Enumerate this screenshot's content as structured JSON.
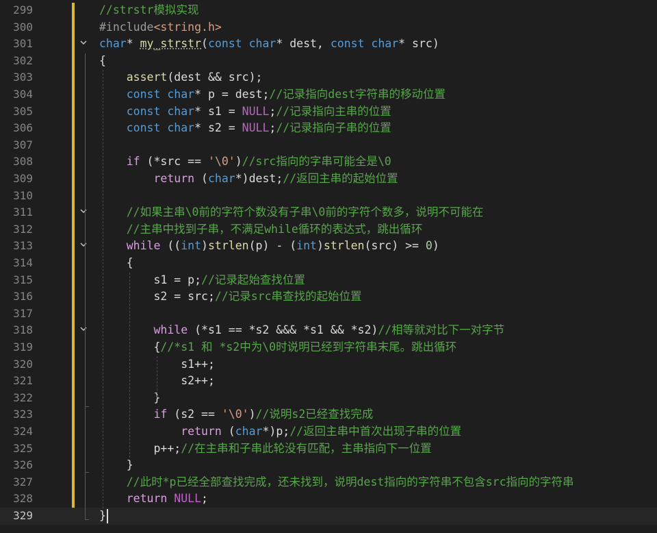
{
  "editor": {
    "current_line": 329,
    "lines": [
      {
        "n": "299",
        "tokens": [
          {
            "t": "//strstr模拟实现",
            "c": "comment"
          }
        ]
      },
      {
        "n": "300",
        "tokens": [
          {
            "t": "#include",
            "c": "inc"
          },
          {
            "t": "<string.h>",
            "c": "str"
          }
        ]
      },
      {
        "n": "301",
        "fold": "open",
        "tokens": [
          {
            "t": "char",
            "c": "kw"
          },
          {
            "t": "* ",
            "c": "plain"
          },
          {
            "t": "my_strstr",
            "c": "fn",
            "u": true
          },
          {
            "t": "(",
            "c": "plain"
          },
          {
            "t": "const",
            "c": "kw"
          },
          {
            "t": " ",
            "c": "plain"
          },
          {
            "t": "char",
            "c": "kw"
          },
          {
            "t": "* dest, ",
            "c": "plain"
          },
          {
            "t": "const",
            "c": "kw"
          },
          {
            "t": " ",
            "c": "plain"
          },
          {
            "t": "char",
            "c": "kw"
          },
          {
            "t": "* src)",
            "c": "plain"
          }
        ]
      },
      {
        "n": "302",
        "tokens": [
          {
            "t": "{",
            "c": "plain"
          }
        ]
      },
      {
        "n": "303",
        "tokens": [
          {
            "t": "    ",
            "c": "plain"
          },
          {
            "t": "assert",
            "c": "fn"
          },
          {
            "t": "(dest && src);",
            "c": "plain"
          }
        ]
      },
      {
        "n": "304",
        "tokens": [
          {
            "t": "    ",
            "c": "plain"
          },
          {
            "t": "const",
            "c": "kw"
          },
          {
            "t": " ",
            "c": "plain"
          },
          {
            "t": "char",
            "c": "kw"
          },
          {
            "t": "* p = dest;",
            "c": "plain"
          },
          {
            "t": "//记录指向dest字符串的移动位置",
            "c": "comment"
          }
        ]
      },
      {
        "n": "305",
        "tokens": [
          {
            "t": "    ",
            "c": "plain"
          },
          {
            "t": "const",
            "c": "kw"
          },
          {
            "t": " ",
            "c": "plain"
          },
          {
            "t": "char",
            "c": "kw"
          },
          {
            "t": "* s1 = ",
            "c": "plain"
          },
          {
            "t": "NULL",
            "c": "macro"
          },
          {
            "t": ";",
            "c": "plain"
          },
          {
            "t": "//记录指向主串的位置",
            "c": "comment"
          }
        ]
      },
      {
        "n": "306",
        "tokens": [
          {
            "t": "    ",
            "c": "plain"
          },
          {
            "t": "const",
            "c": "kw"
          },
          {
            "t": " ",
            "c": "plain"
          },
          {
            "t": "char",
            "c": "kw"
          },
          {
            "t": "* s2 = ",
            "c": "plain"
          },
          {
            "t": "NULL",
            "c": "macro"
          },
          {
            "t": ";",
            "c": "plain"
          },
          {
            "t": "//记录指向子串的位置",
            "c": "comment"
          }
        ]
      },
      {
        "n": "307",
        "tokens": []
      },
      {
        "n": "308",
        "tokens": [
          {
            "t": "    ",
            "c": "plain"
          },
          {
            "t": "if",
            "c": "ctrl"
          },
          {
            "t": " (*src == ",
            "c": "plain"
          },
          {
            "t": "'\\0'",
            "c": "str"
          },
          {
            "t": ")",
            "c": "plain"
          },
          {
            "t": "//src指向的字串可能全是\\0",
            "c": "comment"
          }
        ]
      },
      {
        "n": "309",
        "tokens": [
          {
            "t": "        ",
            "c": "plain"
          },
          {
            "t": "return",
            "c": "ctrl"
          },
          {
            "t": " (",
            "c": "plain"
          },
          {
            "t": "char",
            "c": "kw"
          },
          {
            "t": "*)dest;",
            "c": "plain"
          },
          {
            "t": "//返回主串的起始位置",
            "c": "comment"
          }
        ]
      },
      {
        "n": "310",
        "tokens": []
      },
      {
        "n": "311",
        "fold": "open",
        "tokens": [
          {
            "t": "    ",
            "c": "plain"
          },
          {
            "t": "//如果主串\\0前的字符个数没有子串\\0前的字符个数多，说明不可能在",
            "c": "comment"
          }
        ]
      },
      {
        "n": "312",
        "tokens": [
          {
            "t": "    ",
            "c": "plain"
          },
          {
            "t": "//主串中找到子串，不满足while循环的表达式，跳出循环",
            "c": "comment"
          }
        ]
      },
      {
        "n": "313",
        "fold": "open",
        "tokens": [
          {
            "t": "    ",
            "c": "plain"
          },
          {
            "t": "while",
            "c": "ctrl"
          },
          {
            "t": " ((",
            "c": "plain"
          },
          {
            "t": "int",
            "c": "kw"
          },
          {
            "t": ")",
            "c": "plain"
          },
          {
            "t": "strlen",
            "c": "fn"
          },
          {
            "t": "(p) - (",
            "c": "plain"
          },
          {
            "t": "int",
            "c": "kw"
          },
          {
            "t": ")",
            "c": "plain"
          },
          {
            "t": "strlen",
            "c": "fn"
          },
          {
            "t": "(src) >= ",
            "c": "plain"
          },
          {
            "t": "0",
            "c": "num"
          },
          {
            "t": ")",
            "c": "plain"
          }
        ]
      },
      {
        "n": "314",
        "tokens": [
          {
            "t": "    {",
            "c": "plain"
          }
        ]
      },
      {
        "n": "315",
        "tokens": [
          {
            "t": "        s1 = p;",
            "c": "plain"
          },
          {
            "t": "//记录起始查找位置",
            "c": "comment"
          }
        ]
      },
      {
        "n": "316",
        "tokens": [
          {
            "t": "        s2 = src;",
            "c": "plain"
          },
          {
            "t": "//记录src串查找的起始位置",
            "c": "comment"
          }
        ]
      },
      {
        "n": "317",
        "tokens": []
      },
      {
        "n": "318",
        "fold": "open",
        "tokens": [
          {
            "t": "        ",
            "c": "plain"
          },
          {
            "t": "while",
            "c": "ctrl"
          },
          {
            "t": " (*s1 == *s2 &&& *s1 && *s2)",
            "c": "plain"
          },
          {
            "t": "//相等就对比下一对字节",
            "c": "comment"
          }
        ]
      },
      {
        "n": "319",
        "tokens": [
          {
            "t": "        {",
            "c": "plain"
          },
          {
            "t": "//*s1 和 *s2中为\\0时说明已经到字符串末尾。跳出循环",
            "c": "comment"
          }
        ]
      },
      {
        "n": "320",
        "tokens": [
          {
            "t": "            s1++;",
            "c": "plain"
          }
        ]
      },
      {
        "n": "321",
        "tokens": [
          {
            "t": "            s2++;",
            "c": "plain"
          }
        ]
      },
      {
        "n": "322",
        "tokens": [
          {
            "t": "        }",
            "c": "plain"
          }
        ]
      },
      {
        "n": "323",
        "tokens": [
          {
            "t": "        ",
            "c": "plain"
          },
          {
            "t": "if",
            "c": "ctrl"
          },
          {
            "t": " (s2 == ",
            "c": "plain"
          },
          {
            "t": "'\\0'",
            "c": "str"
          },
          {
            "t": ")",
            "c": "plain"
          },
          {
            "t": "//说明s2已经查找完成",
            "c": "comment"
          }
        ]
      },
      {
        "n": "324",
        "tokens": [
          {
            "t": "            ",
            "c": "plain"
          },
          {
            "t": "return",
            "c": "ctrl"
          },
          {
            "t": " (",
            "c": "plain"
          },
          {
            "t": "char",
            "c": "kw"
          },
          {
            "t": "*)p;",
            "c": "plain"
          },
          {
            "t": "//返回主串中首次出现子串的位置",
            "c": "comment"
          }
        ]
      },
      {
        "n": "325",
        "tokens": [
          {
            "t": "        p++;",
            "c": "plain"
          },
          {
            "t": "//在主串和子串此轮没有匹配，主串指向下一位置",
            "c": "comment"
          }
        ]
      },
      {
        "n": "326",
        "tokens": [
          {
            "t": "    }",
            "c": "plain"
          }
        ]
      },
      {
        "n": "327",
        "tokens": [
          {
            "t": "    ",
            "c": "plain"
          },
          {
            "t": "//此时*p已经全部查找完成，还未找到，说明dest指向的字符串不包含src指向的字符串",
            "c": "comment"
          }
        ]
      },
      {
        "n": "328",
        "tokens": [
          {
            "t": "    ",
            "c": "plain"
          },
          {
            "t": "return",
            "c": "ctrl"
          },
          {
            "t": " ",
            "c": "plain"
          },
          {
            "t": "NULL",
            "c": "macro"
          },
          {
            "t": ";",
            "c": "plain"
          }
        ]
      },
      {
        "n": "329",
        "tokens": [
          {
            "t": "}",
            "c": "plain"
          }
        ]
      }
    ]
  },
  "icons": {
    "fold_open": "chevron-down-icon"
  },
  "colors": {
    "background": "#1e1e1e",
    "line_number": "#858585",
    "comment": "#57a64a",
    "keyword": "#569cd6",
    "control": "#d8a0df",
    "function": "#dcdcaa",
    "string": "#d69d85",
    "macro": "#bd63c5",
    "change_bar": "#d7ba3c"
  }
}
